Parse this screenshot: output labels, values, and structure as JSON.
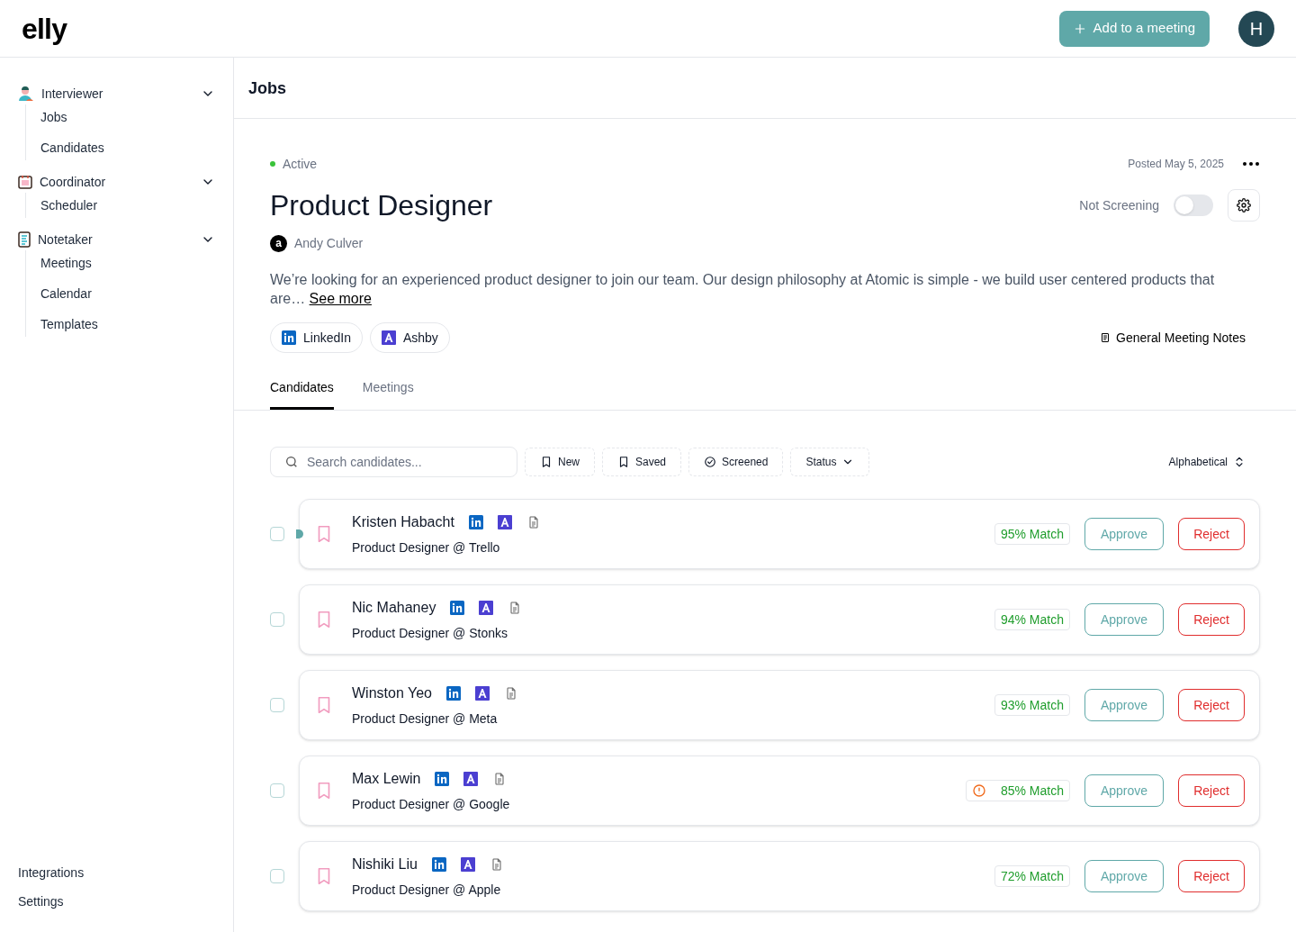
{
  "header": {
    "logo": "elly",
    "add_button": "Add to a meeting",
    "avatar": "H"
  },
  "sidebar": {
    "groups": [
      {
        "label": "Interviewer",
        "kind": "person",
        "expanded": true,
        "items": [
          "Jobs",
          "Candidates"
        ]
      },
      {
        "label": "Coordinator",
        "kind": "calendar",
        "expanded": true,
        "items": [
          "Scheduler"
        ]
      },
      {
        "label": "Notetaker",
        "kind": "notepad",
        "expanded": true,
        "items": [
          "Meetings",
          "Calendar",
          "Templates"
        ]
      }
    ],
    "footer": [
      "Integrations",
      "Settings"
    ]
  },
  "page_title": "Jobs",
  "job": {
    "status": "Active",
    "posted": "Posted May 5, 2025",
    "title": "Product Designer",
    "screening": {
      "label": "Not Screening",
      "on": false
    },
    "owner": {
      "initial": "a",
      "name": "Andy Culver"
    },
    "description": "We’re looking for an experienced product designer to join our team. Our design philosophy at Atomic is simple - we build user centered products that are…",
    "see_more": "See more",
    "sources": [
      {
        "kind": "linkedin",
        "label": "LinkedIn"
      },
      {
        "kind": "ashby",
        "label": "Ashby"
      }
    ],
    "notes_link": "General Meeting Notes"
  },
  "tabs": [
    {
      "label": "Candidates",
      "selected": true
    },
    {
      "label": "Meetings",
      "selected": false
    }
  ],
  "toolbar": {
    "search": {
      "placeholder": "Search candidates..."
    },
    "filters": [
      {
        "kind": "bookmark",
        "label": "New"
      },
      {
        "kind": "bookmark",
        "label": "Saved"
      },
      {
        "kind": "check",
        "label": "Screened"
      },
      {
        "kind": "dropdown",
        "label": "Status"
      }
    ],
    "sort": "Alphabetical"
  },
  "candidates": [
    {
      "name": "Kristen Habacht",
      "role": "Product Designer @ Trello",
      "match": "95% Match",
      "warning": false,
      "unread": true,
      "checked": false,
      "approve": "Approve",
      "reject": "Reject"
    },
    {
      "name": "Nic Mahaney",
      "role": "Product Designer @ Stonks",
      "match": "94% Match",
      "warning": false,
      "unread": false,
      "checked": false,
      "approve": "Approve",
      "reject": "Reject"
    },
    {
      "name": "Winston Yeo",
      "role": "Product Designer @ Meta",
      "match": "93% Match",
      "warning": false,
      "unread": false,
      "checked": false,
      "approve": "Approve",
      "reject": "Reject"
    },
    {
      "name": "Max Lewin",
      "role": "Product Designer @ Google",
      "match": "85% Match",
      "warning": true,
      "unread": false,
      "checked": false,
      "approve": "Approve",
      "reject": "Reject"
    },
    {
      "name": "Nishiki Liu",
      "role": "Product Designer @ Apple",
      "match": "72% Match",
      "warning": false,
      "unread": false,
      "checked": false,
      "approve": "Approve",
      "reject": "Reject"
    }
  ]
}
